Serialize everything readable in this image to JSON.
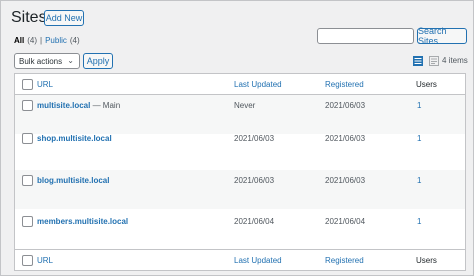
{
  "header": {
    "title": "Sites",
    "add_new_label": "Add New"
  },
  "filters": {
    "all_label": "All",
    "all_count": "(4)",
    "separator": "|",
    "public_label": "Public",
    "public_count": "(4)"
  },
  "search": {
    "value": "",
    "button_label": "Search Sites"
  },
  "bulk": {
    "selected": "Bulk actions",
    "apply_label": "Apply"
  },
  "view": {
    "list_icon": "list-view-icon",
    "excerpt_icon": "excerpt-view-icon",
    "item_count": "4 items"
  },
  "table": {
    "columns": {
      "url": "URL",
      "last_updated": "Last Updated",
      "registered": "Registered",
      "users": "Users"
    },
    "rows": [
      {
        "url": "multisite.local",
        "suffix": " — Main",
        "last_updated": "Never",
        "registered": "2021/06/03",
        "users": "1"
      },
      {
        "url": "shop.multisite.local",
        "suffix": "",
        "last_updated": "2021/06/03",
        "registered": "2021/06/03",
        "users": "1"
      },
      {
        "url": "blog.multisite.local",
        "suffix": "",
        "last_updated": "2021/06/03",
        "registered": "2021/06/03",
        "users": "1"
      },
      {
        "url": "members.multisite.local",
        "suffix": "",
        "last_updated": "2021/06/04",
        "registered": "2021/06/04",
        "users": "1"
      }
    ]
  },
  "colors": {
    "accent": "#2271b1",
    "background": "#f0f0f1"
  }
}
